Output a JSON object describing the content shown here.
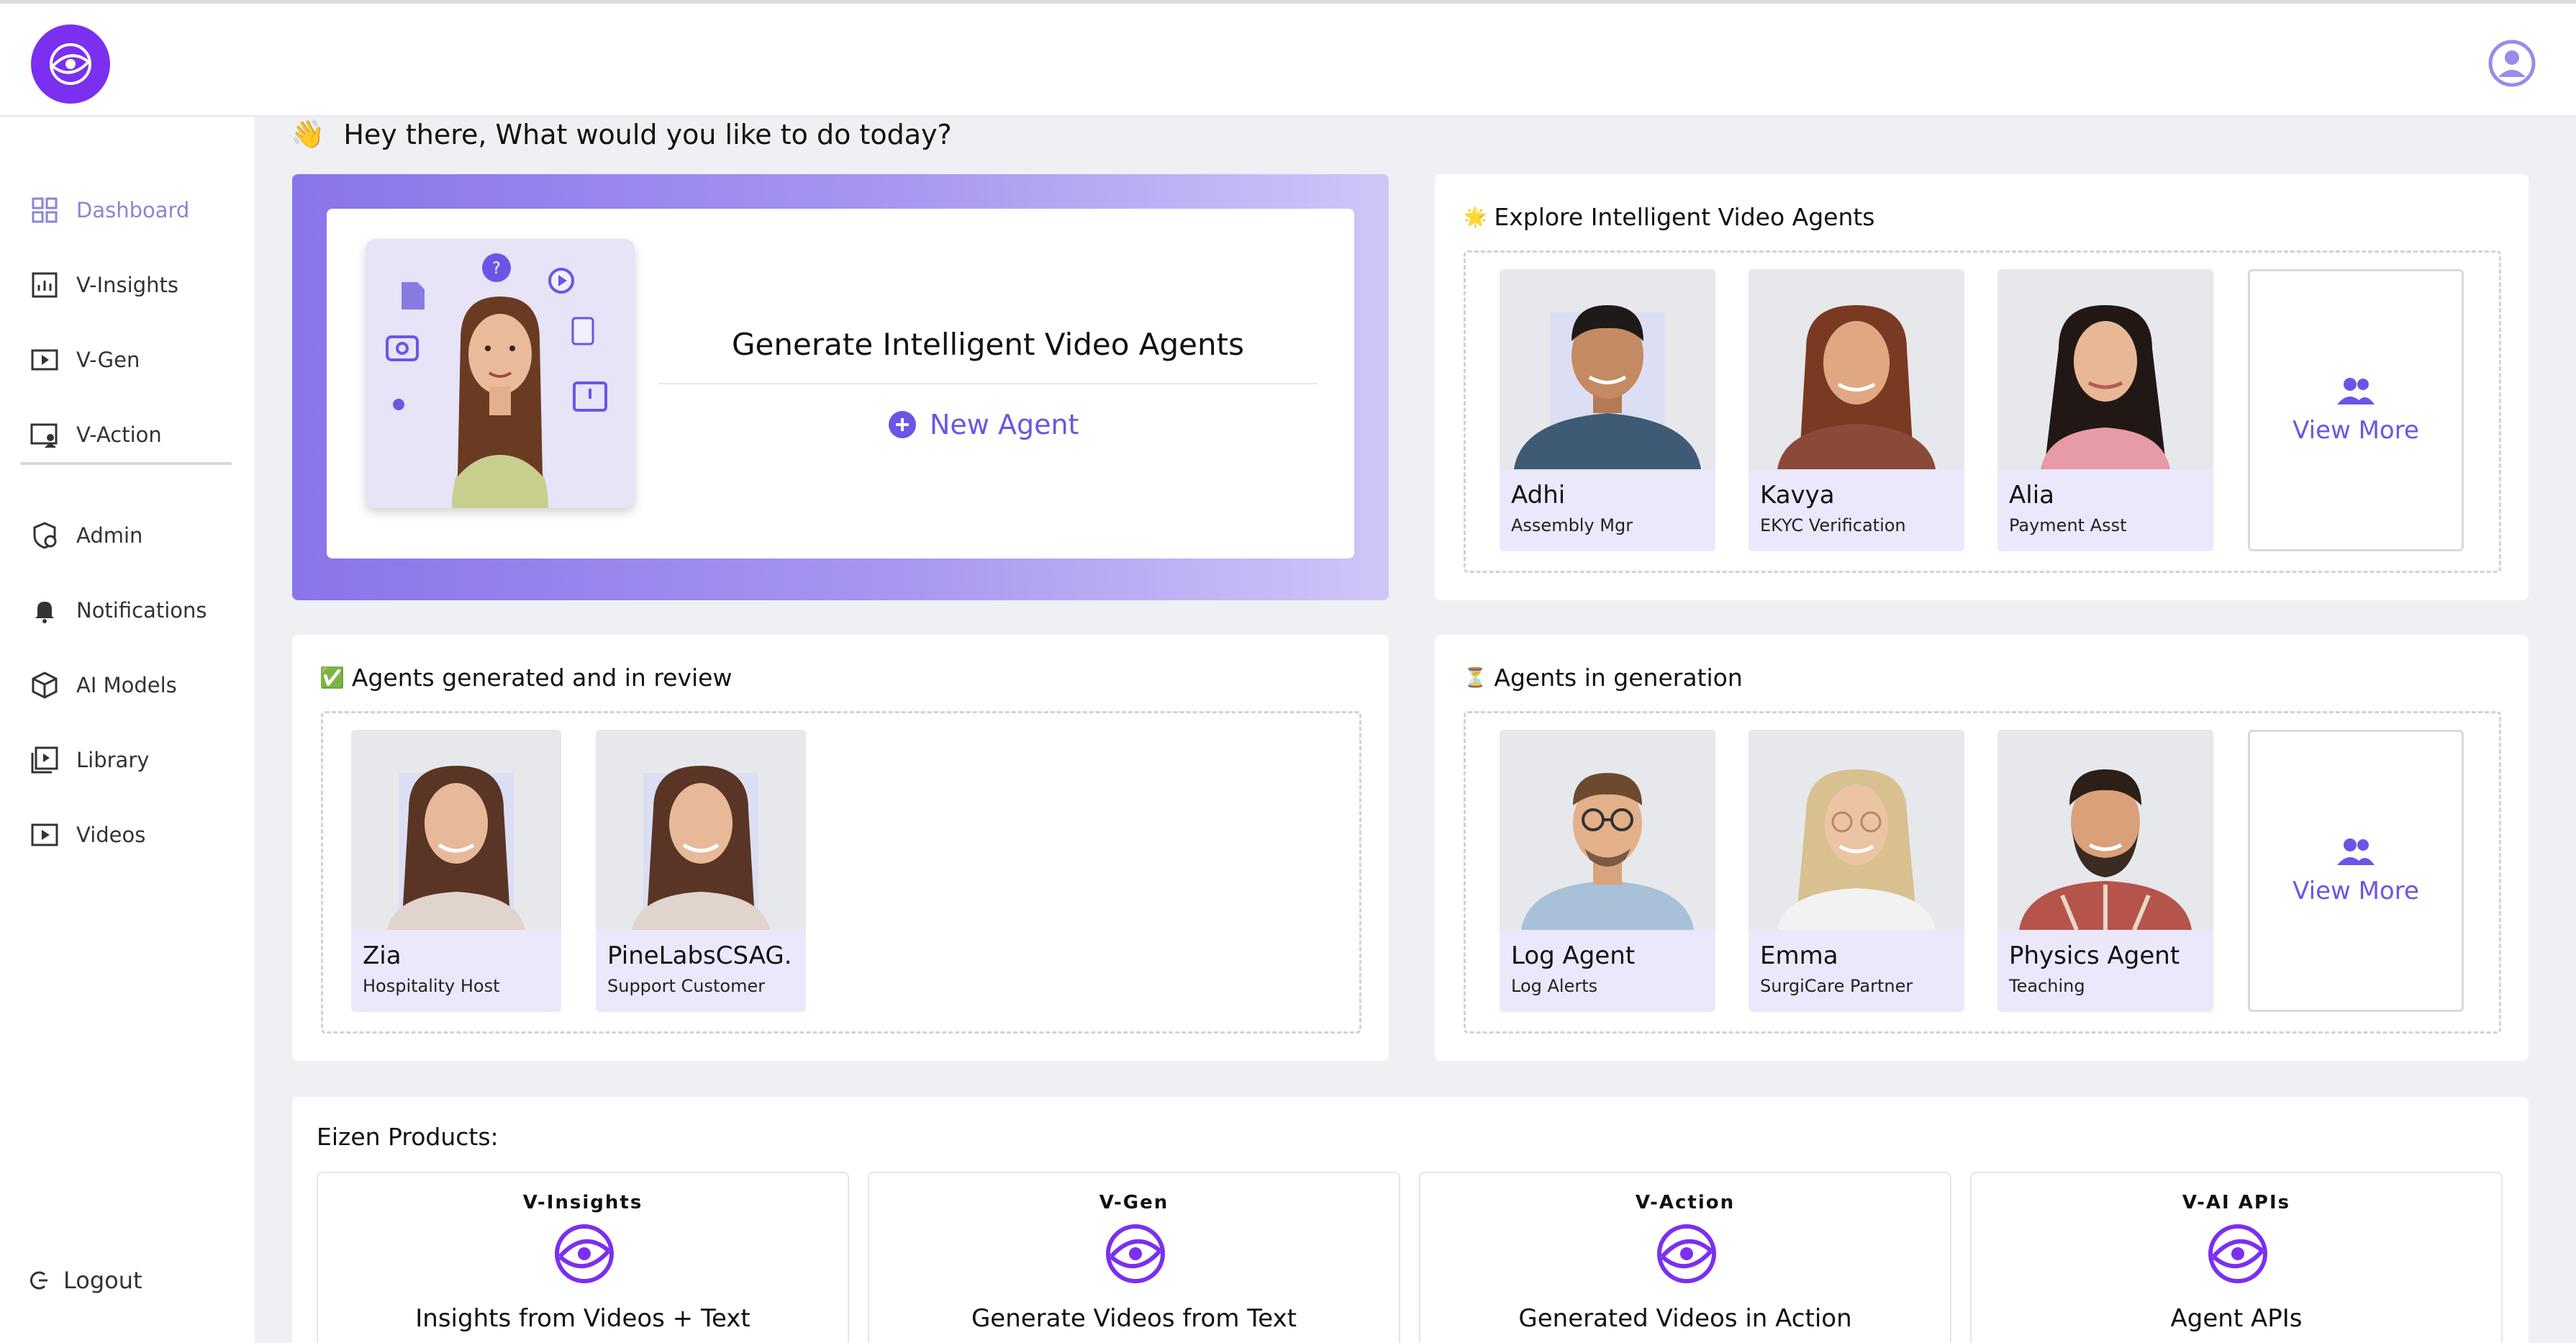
{
  "header": {
    "logo_name": "eye-logo",
    "avatar_name": "user-avatar"
  },
  "sidebar": {
    "items": [
      {
        "label": "Dashboard",
        "icon": "grid-icon",
        "active": true
      },
      {
        "label": "V-Insights",
        "icon": "chart-icon",
        "active": false
      },
      {
        "label": "V-Gen",
        "icon": "play-box-icon",
        "active": false
      },
      {
        "label": "V-Action",
        "icon": "person-screen-icon",
        "active": false
      },
      {
        "label": "Admin",
        "icon": "admin-shield-icon",
        "active": false
      },
      {
        "label": "Notifications",
        "icon": "bell-icon",
        "active": false
      },
      {
        "label": "AI Models",
        "icon": "cube-icon",
        "active": false
      },
      {
        "label": "Library",
        "icon": "library-icon",
        "active": false
      },
      {
        "label": "Videos",
        "icon": "video-icon",
        "active": false
      }
    ],
    "logout_label": "Logout"
  },
  "greeting": {
    "emoji": "👋",
    "text": "Hey there, What would you like to do today?"
  },
  "hero": {
    "title": "Generate Intelligent Video Agents",
    "new_agent_label": "New Agent"
  },
  "explore": {
    "emoji": "🌟",
    "title": "Explore Intelligent Video Agents",
    "agents": [
      {
        "name": "Adhi",
        "role": "Assembly Mgr"
      },
      {
        "name": "Kavya",
        "role": "EKYC Verification"
      },
      {
        "name": "Alia",
        "role": "Payment Asst"
      }
    ],
    "view_more_label": "View More"
  },
  "review": {
    "emoji": "✅",
    "title": "Agents generated and in review",
    "agents": [
      {
        "name": "Zia",
        "role": "Hospitality Host"
      },
      {
        "name": "PineLabsCSAG...",
        "role": "Support Customer"
      }
    ]
  },
  "generation": {
    "emoji": "⏳",
    "title": "Agents in generation",
    "agents": [
      {
        "name": "Log Agent",
        "role": "Log Alerts"
      },
      {
        "name": "Emma",
        "role": "SurgiCare Partner"
      },
      {
        "name": "Physics Agent",
        "role": "Teaching"
      }
    ],
    "view_more_label": "View More"
  },
  "products": {
    "title": "Eizen Products:",
    "items": [
      {
        "badge": "V-Insights",
        "label": "Insights from Videos + Text"
      },
      {
        "badge": "V-Gen",
        "label": "Generate Videos from Text"
      },
      {
        "badge": "V-Action",
        "label": "Generated Videos in Action"
      },
      {
        "badge": "V-AI APIs",
        "label": "Agent APIs"
      }
    ]
  },
  "colors": {
    "accent": "#6a55e6",
    "logo": "#7b2ff0",
    "sidebar_active": "#8a84d8"
  }
}
